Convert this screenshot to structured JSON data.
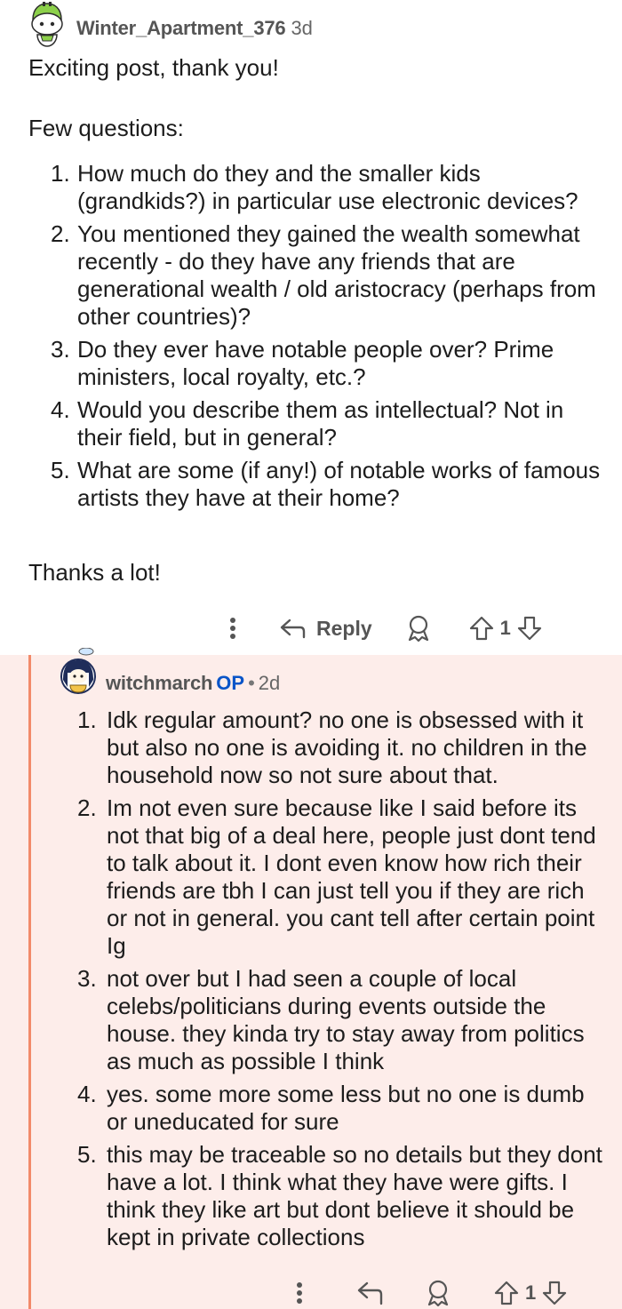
{
  "comment": {
    "author": "Winter_Apartment_376",
    "age": "3d",
    "greeting": "Exciting post, thank you!",
    "intro": "Few questions:",
    "questions": [
      {
        "num": "1.",
        "text": "How much do they and the smaller kids (grandkids?) in particular use electronic devices?"
      },
      {
        "num": "2.",
        "text": "You mentioned they gained the wealth somewhat recently - do they have any friends that are generational wealth / old aristocracy (perhaps from other countries)?"
      },
      {
        "num": "3.",
        "text": "Do they ever have notable people over? Prime ministers, local royalty, etc.?"
      },
      {
        "num": "4.",
        "text": "Would you describe them as intellectual? Not in their field, but in general?"
      },
      {
        "num": "5.",
        "text": "What are some (if any!) of notable works of famous artists they have at their home?"
      }
    ],
    "closing": "Thanks a lot!",
    "actions": {
      "reply_label": "Reply",
      "vote_count": "1"
    }
  },
  "reply": {
    "author": "witchmarch",
    "op_badge": "OP",
    "separator": "•",
    "age": "2d",
    "answers": [
      {
        "num": "1.",
        "text": "Idk regular amount? no one is obsessed with it but also no one is avoiding it. no children in the household now so not sure about that."
      },
      {
        "num": "2.",
        "text": "Im not even sure because like I said before its not that big of a deal here, people just dont tend to talk about it. I dont even know how rich their friends are tbh I can just tell you if they are rich or not in general. you cant tell after certain point Ig"
      },
      {
        "num": "3.",
        "text": "not over but I had seen a couple of local celebs/politicians during events outside the house. they kinda try to stay away from politics as much as possible I think"
      },
      {
        "num": "4.",
        "text": "yes. some more some less but no one is dumb or uneducated for sure"
      },
      {
        "num": "5.",
        "text": "this may be traceable so no details but they dont have a lot. I think what they have were gifts. I think they like art but dont believe it should be kept in private collections"
      }
    ],
    "actions": {
      "vote_count": "1"
    }
  },
  "colors": {
    "reply_background": "#fdedea",
    "thread_line": "#f28a6a",
    "op_badge": "#0a55c8",
    "meta_text": "#555555"
  },
  "icons": [
    "snoo-avatar-icon",
    "more-options-icon",
    "reply-arrow-icon",
    "award-icon",
    "upvote-icon",
    "downvote-icon"
  ]
}
